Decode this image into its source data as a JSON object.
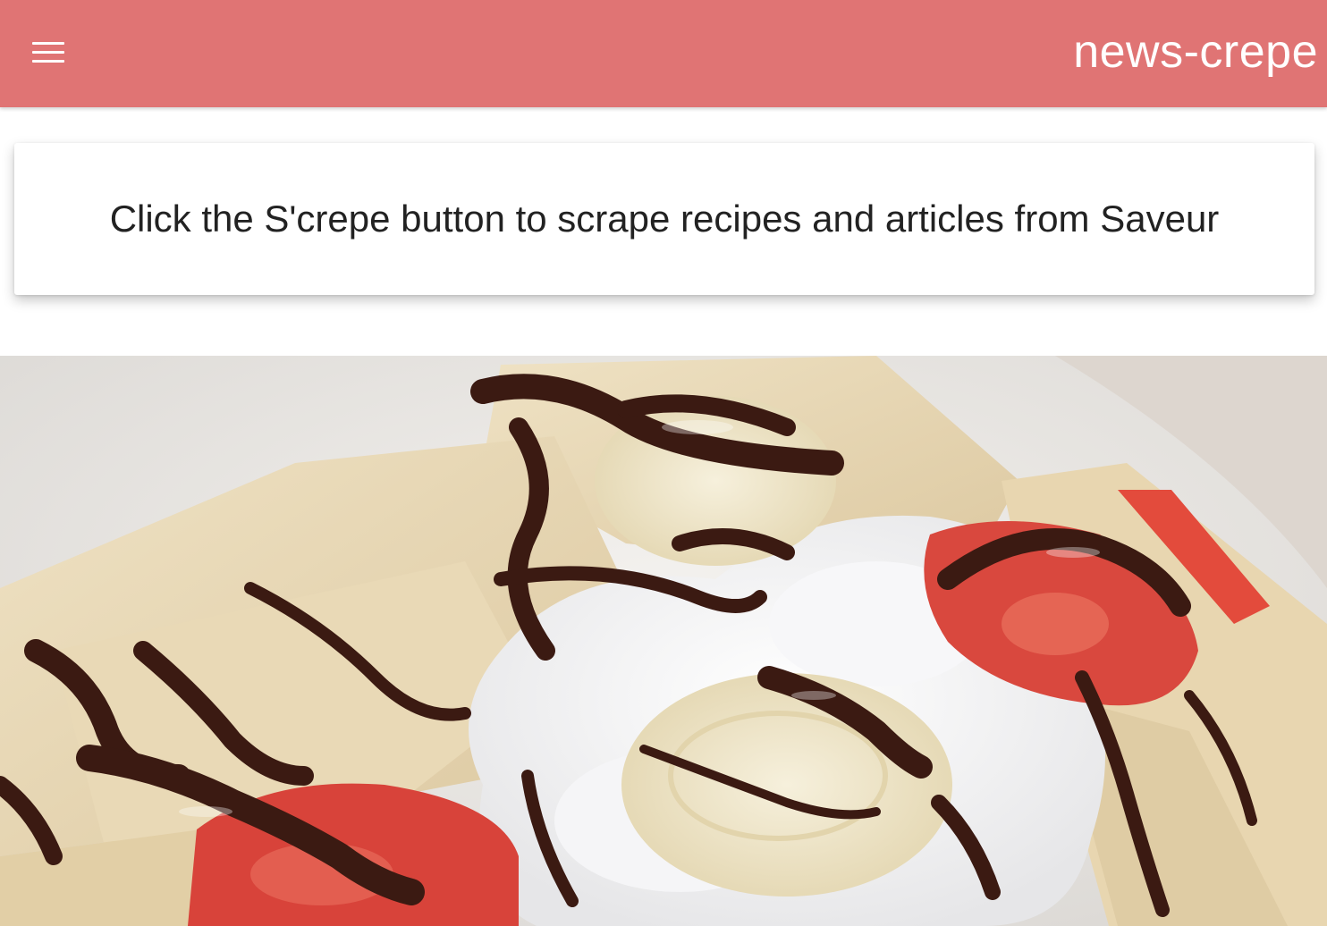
{
  "header": {
    "brand": "news-crepe",
    "menu_icon": "hamburger-menu-icon",
    "background_color": "#e07474"
  },
  "intro_card": {
    "message": "Click the S'crepe button to scrape recipes and articles from Saveur"
  },
  "hero": {
    "image": "crepes-with-banana-strawberry-chocolate-and-cream"
  }
}
